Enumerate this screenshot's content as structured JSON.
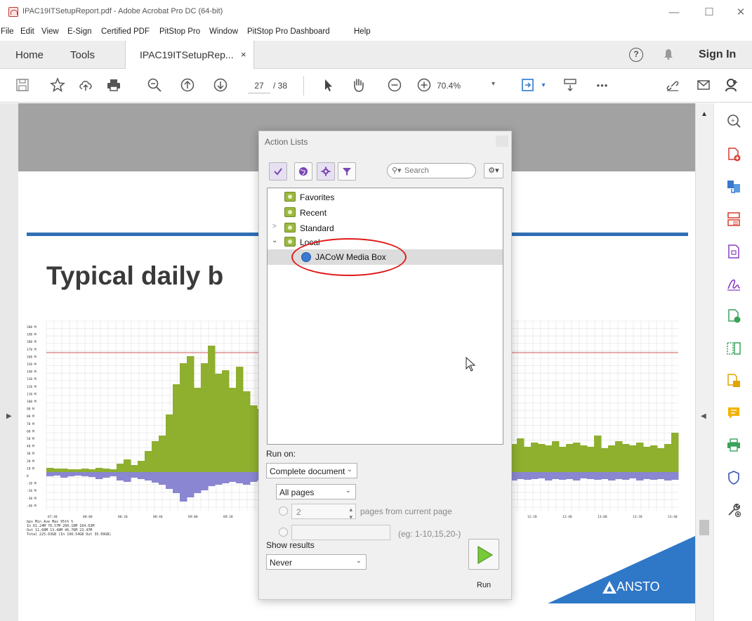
{
  "window": {
    "title": "IPAC19ITSetupReport.pdf - Adobe Acrobat Pro DC (64-bit)",
    "controls": {
      "minimize": "—",
      "maximize": "☐",
      "close": "✕"
    }
  },
  "menu": [
    "File",
    "Edit",
    "View",
    "E-Sign",
    "Certified PDF",
    "PitStop Pro",
    "Window",
    "PitStop Pro Dashboard",
    "Help"
  ],
  "tabs": {
    "home": "Home",
    "tools": "Tools",
    "document": "IPAC19ITSetupRep...",
    "close": "×"
  },
  "header": {
    "help": "?",
    "signin": "Sign In"
  },
  "toolbar": {
    "page_current": "27",
    "page_total": "/ 38",
    "zoom": "70.4%",
    "more": "•••"
  },
  "slide": {
    "title": "Typical daily b",
    "logo_text": "ANSTO",
    "chart_legend": [
      "bps      Min      Ave      Max    95th %",
      "In    61.24M   70.57M  200.10M  164.63M",
      "Out   11.68M   13.48M   46.76M   23.47M",
      "Total 225.63GB  (In 190.54GB  Out 35.09GB)"
    ],
    "x_ticks_left": [
      "07:40",
      "08:00",
      "08:20",
      "08:40",
      "09:00",
      "09:20"
    ],
    "x_ticks_right": [
      "12:20",
      "12:40",
      "13:00",
      "13:20",
      "13:40"
    ],
    "y_ticks": [
      "200 M",
      "190 M",
      "180 M",
      "170 M",
      "160 M",
      "150 M",
      "140 M",
      "130 M",
      "120 M",
      "110 M",
      "100 M",
      "90 M",
      "80 M",
      "70 M",
      "60 M",
      "50 M",
      "40 M",
      "30 M",
      "20 M",
      "10 M",
      "0",
      "-10 M",
      "-20 M",
      "-30 M",
      "-40 M"
    ]
  },
  "dialog": {
    "title": "Action Lists",
    "search_placeholder": "Search",
    "tree": [
      {
        "label": "Favorites"
      },
      {
        "label": "Recent"
      },
      {
        "label": "Standard"
      },
      {
        "label": "Local"
      },
      {
        "label": "JACoW Media Box"
      }
    ],
    "run_on_label": "Run on:",
    "run_on_value": "Complete document",
    "pages_value": "All pages",
    "pages_count": "2",
    "pages_from_label": "pages from current page",
    "range_hint": "(eg: 1-10,15,20-)",
    "show_results_label": "Show results",
    "show_results_value": "Never",
    "run_label": "Run"
  },
  "colors": {
    "chart_in": "#8faf2e",
    "chart_out": "#8a86d1",
    "accent_blue": "#2f6fb4",
    "highlight_circle": "#e01a1a"
  }
}
